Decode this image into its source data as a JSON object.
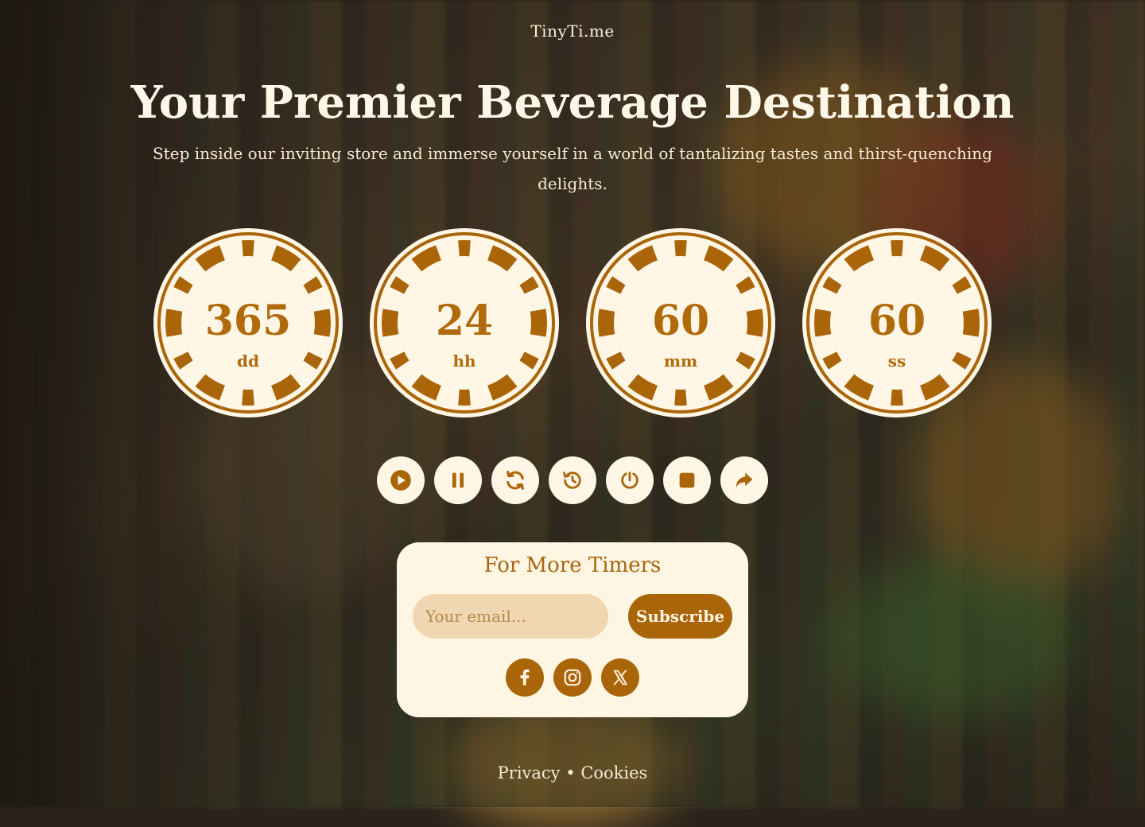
{
  "brand": "TinyTi.me",
  "hero": {
    "title": "Your Premier Beverage Destination",
    "subtitle": "Step inside our inviting store and immerse yourself in a world of tantalizing tastes and thirst-quenching delights."
  },
  "timers": [
    {
      "value": "365",
      "unit": "dd"
    },
    {
      "value": "24",
      "unit": "hh"
    },
    {
      "value": "60",
      "unit": "mm"
    },
    {
      "value": "60",
      "unit": "ss"
    }
  ],
  "controls": [
    {
      "name": "play-icon"
    },
    {
      "name": "pause-icon"
    },
    {
      "name": "refresh-icon"
    },
    {
      "name": "history-icon"
    },
    {
      "name": "timer-reset-icon"
    },
    {
      "name": "stop-icon"
    },
    {
      "name": "share-icon"
    }
  ],
  "subscribe": {
    "title": "For More Timers",
    "email_placeholder": "Your email...",
    "button_label": "Subscribe"
  },
  "social": [
    "facebook-icon",
    "instagram-icon",
    "x-icon"
  ],
  "footer": {
    "privacy": "Privacy",
    "separator": "•",
    "cookies": "Cookies"
  },
  "colors": {
    "accent": "#aa6509",
    "card_bg": "#fff5e3",
    "input_bg": "#f0d7b1"
  }
}
